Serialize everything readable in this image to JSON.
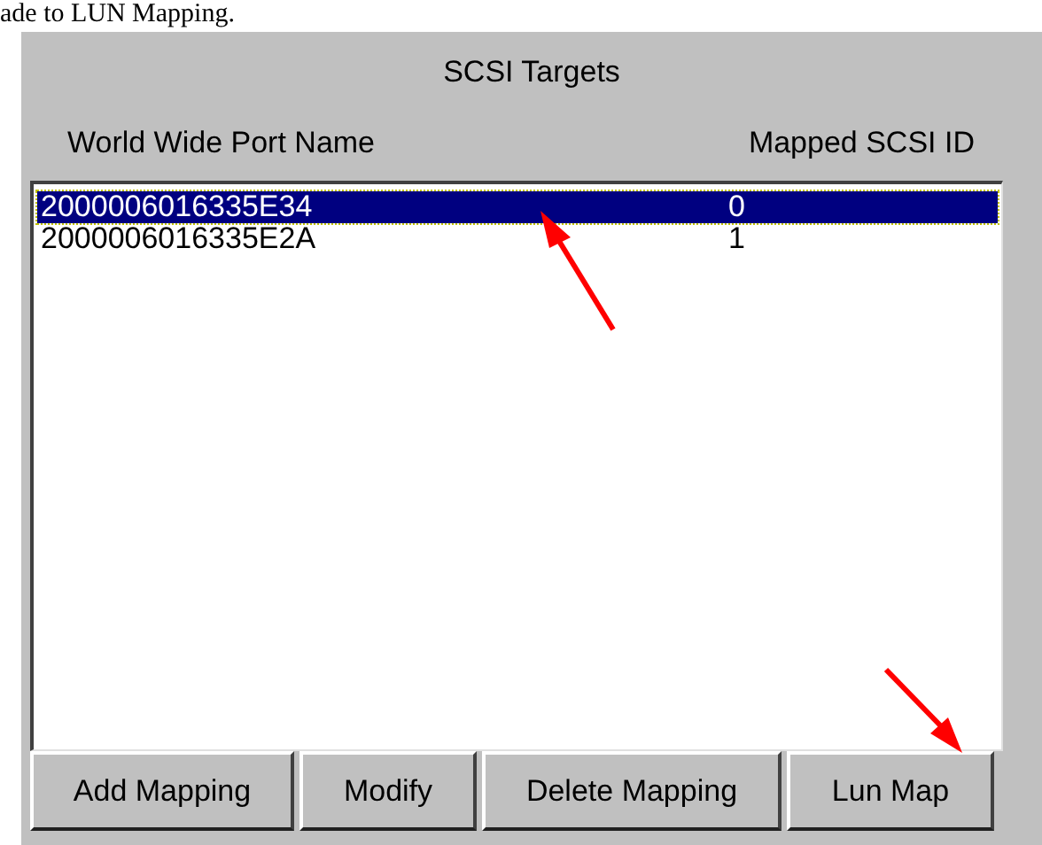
{
  "caption": "ade to LUN Mapping.",
  "group_title": "SCSI Targets",
  "columns": [
    "World Wide Port Name",
    "Mapped SCSI ID"
  ],
  "rows": [
    {
      "port_name": "2000006016335E34",
      "scsi_id": "0",
      "selected": true
    },
    {
      "port_name": "2000006016335E2A",
      "scsi_id": "1",
      "selected": false
    }
  ],
  "buttons": [
    "Add Mapping",
    "Modify",
    "Delete Mapping",
    "Lun Map"
  ]
}
